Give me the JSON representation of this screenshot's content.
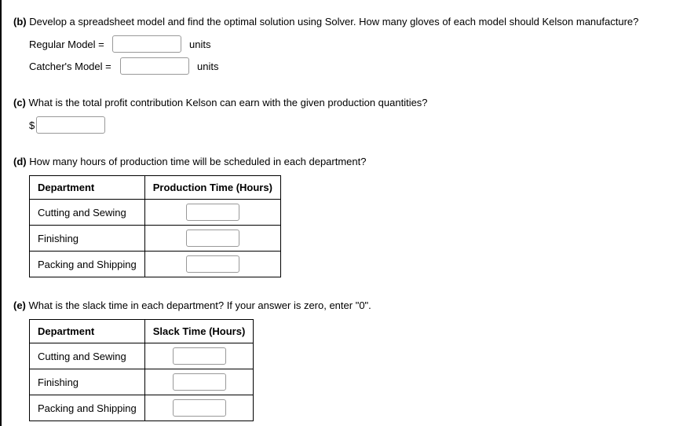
{
  "parts": {
    "b": {
      "label": "(b)",
      "question": "Develop a spreadsheet model and find the optimal solution using Solver. How many gloves of each model should Kelson manufacture?",
      "fields": [
        {
          "label": "Regular Model =",
          "unit": "units"
        },
        {
          "label": "Catcher's Model =",
          "unit": "units"
        }
      ]
    },
    "c": {
      "label": "(c)",
      "question": "What is the total profit contribution Kelson can earn with the given production quantities?",
      "prefix": "$"
    },
    "d": {
      "label": "(d)",
      "question": "How many hours of production time will be scheduled in each department?",
      "table": {
        "headers": [
          "Department",
          "Production Time (Hours)"
        ],
        "rows": [
          "Cutting and Sewing",
          "Finishing",
          "Packing and Shipping"
        ]
      }
    },
    "e": {
      "label": "(e)",
      "question": "What is the slack time in each department? If your answer is zero, enter \"0\".",
      "table": {
        "headers": [
          "Department",
          "Slack Time (Hours)"
        ],
        "rows": [
          "Cutting and Sewing",
          "Finishing",
          "Packing and Shipping"
        ]
      }
    }
  },
  "chart_data": {
    "type": "table",
    "tables": [
      {
        "title": "Production Time (Hours)",
        "columns": [
          "Department",
          "Production Time (Hours)"
        ],
        "rows": [
          [
            "Cutting and Sewing",
            null
          ],
          [
            "Finishing",
            null
          ],
          [
            "Packing and Shipping",
            null
          ]
        ]
      },
      {
        "title": "Slack Time (Hours)",
        "columns": [
          "Department",
          "Slack Time (Hours)"
        ],
        "rows": [
          [
            "Cutting and Sewing",
            null
          ],
          [
            "Finishing",
            null
          ],
          [
            "Packing and Shipping",
            null
          ]
        ]
      }
    ]
  }
}
